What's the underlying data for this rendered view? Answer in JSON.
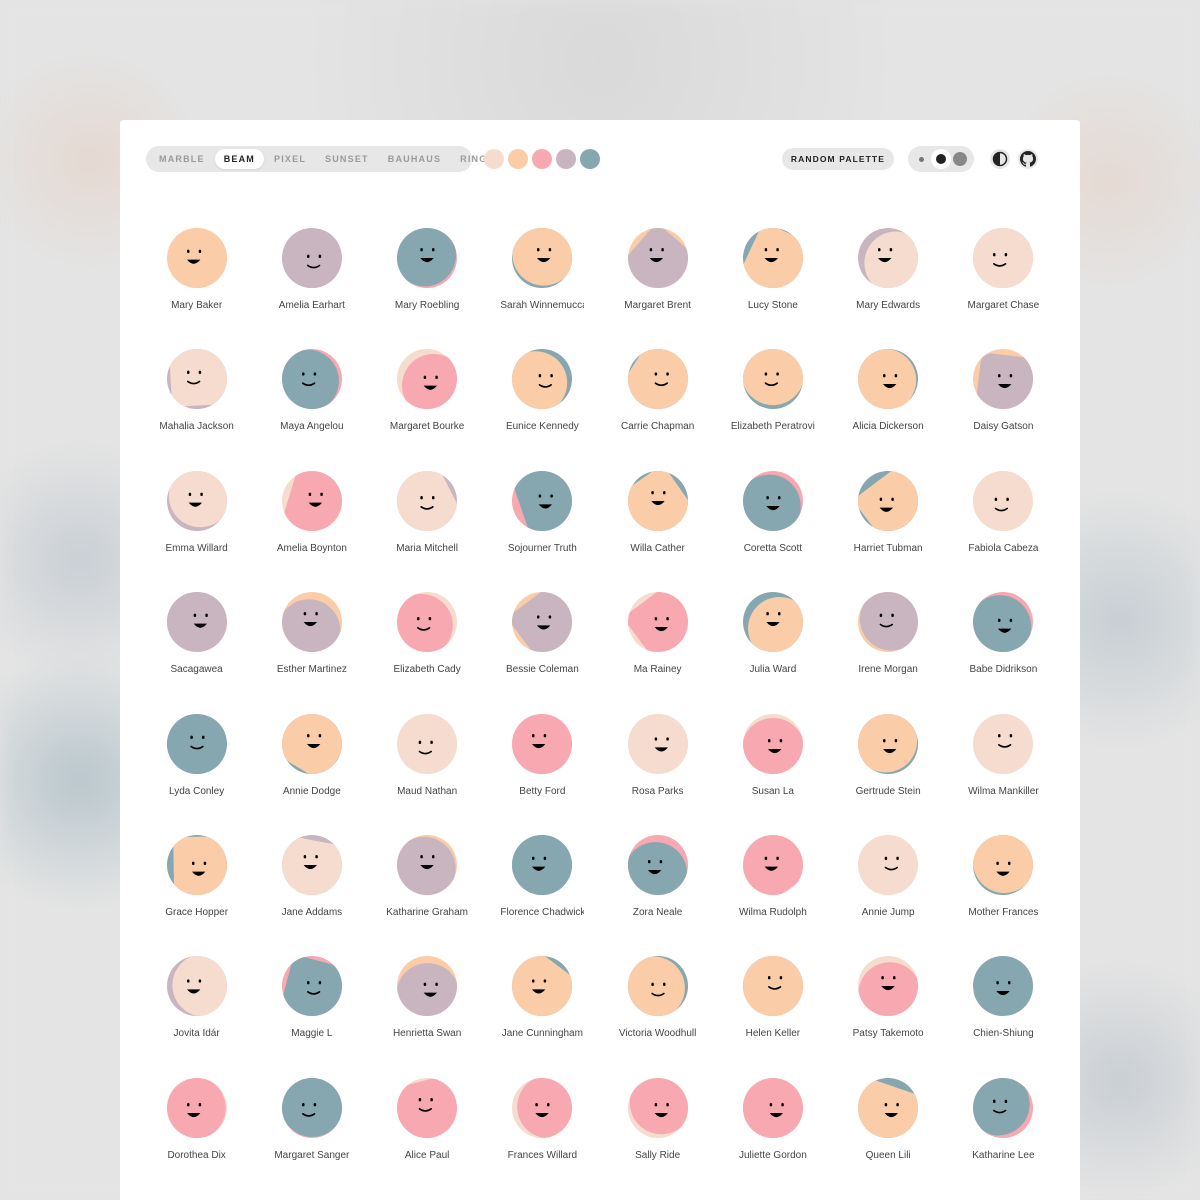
{
  "toolbar": {
    "variants": [
      "MARBLE",
      "BEAM",
      "PIXEL",
      "SUNSET",
      "BAUHAUS",
      "RING"
    ],
    "active_variant": "BEAM",
    "palette": [
      "#f6dccf",
      "#fbcca8",
      "#f7a8b0",
      "#c9b5bf",
      "#86a7b0"
    ],
    "random_palette_label": "RANDOM PALETTE",
    "size_options": [
      "small",
      "medium",
      "large"
    ],
    "active_size": "medium",
    "theme_icon": "contrast-icon",
    "github_icon": "github-icon"
  },
  "avatars": [
    {
      "name": "Mary Baker",
      "bg": "#fbcca8",
      "shape": "#fbcca8",
      "face": "#000"
    },
    {
      "name": "Amelia Earhart",
      "bg": "#c9b5bf",
      "shape": "#c9b5bf",
      "face": "#000"
    },
    {
      "name": "Mary Roebling",
      "bg": "#f7a8b0",
      "shape": "#86a7b0",
      "face": "#000"
    },
    {
      "name": "Sarah Winnemucca",
      "bg": "#86a7b0",
      "shape": "#fbcca8",
      "face": "#000"
    },
    {
      "name": "Margaret Brent",
      "bg": "#fbcca8",
      "shape": "#c9b5bf",
      "face": "#000"
    },
    {
      "name": "Lucy Stone",
      "bg": "#86a7b0",
      "shape": "#fbcca8",
      "face": "#000"
    },
    {
      "name": "Mary Edwards",
      "bg": "#c9b5bf",
      "shape": "#f6dccf",
      "face": "#000"
    },
    {
      "name": "Margaret Chase",
      "bg": "#c9b5bf",
      "shape": "#f6dccf",
      "face": "#000"
    },
    {
      "name": "Mahalia Jackson",
      "bg": "#c9b5bf",
      "shape": "#f6dccf",
      "face": "#000"
    },
    {
      "name": "Maya Angelou",
      "bg": "#f7a8b0",
      "shape": "#86a7b0",
      "face": "#000"
    },
    {
      "name": "Margaret Bourke",
      "bg": "#f6dccf",
      "shape": "#f7a8b0",
      "face": "#000"
    },
    {
      "name": "Eunice Kennedy",
      "bg": "#86a7b0",
      "shape": "#fbcca8",
      "face": "#000"
    },
    {
      "name": "Carrie Chapman",
      "bg": "#86a7b0",
      "shape": "#fbcca8",
      "face": "#000"
    },
    {
      "name": "Elizabeth Peratrovich",
      "bg": "#86a7b0",
      "shape": "#fbcca8",
      "face": "#000"
    },
    {
      "name": "Alicia Dickerson",
      "bg": "#86a7b0",
      "shape": "#fbcca8",
      "face": "#000"
    },
    {
      "name": "Daisy Gatson",
      "bg": "#fbcca8",
      "shape": "#c9b5bf",
      "face": "#000"
    },
    {
      "name": "Emma Willard",
      "bg": "#c9b5bf",
      "shape": "#f6dccf",
      "face": "#000"
    },
    {
      "name": "Amelia Boynton",
      "bg": "#f6dccf",
      "shape": "#f7a8b0",
      "face": "#000"
    },
    {
      "name": "Maria Mitchell",
      "bg": "#c9b5bf",
      "shape": "#f6dccf",
      "face": "#000"
    },
    {
      "name": "Sojourner Truth",
      "bg": "#f7a8b0",
      "shape": "#86a7b0",
      "face": "#000"
    },
    {
      "name": "Willa Cather",
      "bg": "#86a7b0",
      "shape": "#fbcca8",
      "face": "#000"
    },
    {
      "name": "Coretta Scott",
      "bg": "#f7a8b0",
      "shape": "#86a7b0",
      "face": "#000"
    },
    {
      "name": "Harriet Tubman",
      "bg": "#86a7b0",
      "shape": "#fbcca8",
      "face": "#000"
    },
    {
      "name": "Fabiola Cabeza",
      "bg": "#f6dccf",
      "shape": "#f6dccf",
      "face": "#000"
    },
    {
      "name": "Sacagawea",
      "bg": "#c9b5bf",
      "shape": "#c9b5bf",
      "face": "#000"
    },
    {
      "name": "Esther Martinez",
      "bg": "#fbcca8",
      "shape": "#c9b5bf",
      "face": "#000"
    },
    {
      "name": "Elizabeth Cady",
      "bg": "#f6dccf",
      "shape": "#f7a8b0",
      "face": "#000"
    },
    {
      "name": "Bessie Coleman",
      "bg": "#fbcca8",
      "shape": "#c9b5bf",
      "face": "#000"
    },
    {
      "name": "Ma Rainey",
      "bg": "#f6dccf",
      "shape": "#f7a8b0",
      "face": "#000"
    },
    {
      "name": "Julia Ward",
      "bg": "#86a7b0",
      "shape": "#fbcca8",
      "face": "#000"
    },
    {
      "name": "Irene Morgan",
      "bg": "#fbcca8",
      "shape": "#c9b5bf",
      "face": "#000"
    },
    {
      "name": "Babe Didrikson",
      "bg": "#f7a8b0",
      "shape": "#86a7b0",
      "face": "#000"
    },
    {
      "name": "Lyda Conley",
      "bg": "#86a7b0",
      "shape": "#86a7b0",
      "face": "#000"
    },
    {
      "name": "Annie Dodge",
      "bg": "#86a7b0",
      "shape": "#fbcca8",
      "face": "#000"
    },
    {
      "name": "Maud Nathan",
      "bg": "#f6dccf",
      "shape": "#f6dccf",
      "face": "#000"
    },
    {
      "name": "Betty Ford",
      "bg": "#f7a8b0",
      "shape": "#f7a8b0",
      "face": "#000"
    },
    {
      "name": "Rosa Parks",
      "bg": "#f6dccf",
      "shape": "#f6dccf",
      "face": "#000"
    },
    {
      "name": "Susan La",
      "bg": "#f6dccf",
      "shape": "#f7a8b0",
      "face": "#000"
    },
    {
      "name": "Gertrude Stein",
      "bg": "#86a7b0",
      "shape": "#fbcca8",
      "face": "#000"
    },
    {
      "name": "Wilma Mankiller",
      "bg": "#f6dccf",
      "shape": "#f6dccf",
      "face": "#000"
    },
    {
      "name": "Grace Hopper",
      "bg": "#86a7b0",
      "shape": "#fbcca8",
      "face": "#000"
    },
    {
      "name": "Jane Addams",
      "bg": "#c9b5bf",
      "shape": "#f6dccf",
      "face": "#000"
    },
    {
      "name": "Katharine Graham",
      "bg": "#fbcca8",
      "shape": "#c9b5bf",
      "face": "#000"
    },
    {
      "name": "Florence Chadwick",
      "bg": "#86a7b0",
      "shape": "#86a7b0",
      "face": "#000"
    },
    {
      "name": "Zora Neale",
      "bg": "#f7a8b0",
      "shape": "#86a7b0",
      "face": "#000"
    },
    {
      "name": "Wilma Rudolph",
      "bg": "#f6dccf",
      "shape": "#f7a8b0",
      "face": "#000"
    },
    {
      "name": "Annie Jump",
      "bg": "#f6dccf",
      "shape": "#f6dccf",
      "face": "#000"
    },
    {
      "name": "Mother Frances",
      "bg": "#86a7b0",
      "shape": "#fbcca8",
      "face": "#000"
    },
    {
      "name": "Jovita Idár",
      "bg": "#c9b5bf",
      "shape": "#f6dccf",
      "face": "#000"
    },
    {
      "name": "Maggie L",
      "bg": "#f7a8b0",
      "shape": "#86a7b0",
      "face": "#000"
    },
    {
      "name": "Henrietta Swan",
      "bg": "#fbcca8",
      "shape": "#c9b5bf",
      "face": "#000"
    },
    {
      "name": "Jane Cunningham",
      "bg": "#86a7b0",
      "shape": "#fbcca8",
      "face": "#000"
    },
    {
      "name": "Victoria Woodhull",
      "bg": "#86a7b0",
      "shape": "#fbcca8",
      "face": "#000"
    },
    {
      "name": "Helen Keller",
      "bg": "#86a7b0",
      "shape": "#fbcca8",
      "face": "#000"
    },
    {
      "name": "Patsy Takemoto",
      "bg": "#f6dccf",
      "shape": "#f7a8b0",
      "face": "#000"
    },
    {
      "name": "Chien-Shiung",
      "bg": "#f7a8b0",
      "shape": "#86a7b0",
      "face": "#000"
    },
    {
      "name": "Dorothea Dix",
      "bg": "#f6dccf",
      "shape": "#f7a8b0",
      "face": "#000"
    },
    {
      "name": "Margaret Sanger",
      "bg": "#f7a8b0",
      "shape": "#86a7b0",
      "face": "#000"
    },
    {
      "name": "Alice Paul",
      "bg": "#f6dccf",
      "shape": "#f7a8b0",
      "face": "#000"
    },
    {
      "name": "Frances Willard",
      "bg": "#f6dccf",
      "shape": "#f7a8b0",
      "face": "#000"
    },
    {
      "name": "Sally Ride",
      "bg": "#f6dccf",
      "shape": "#f7a8b0",
      "face": "#000"
    },
    {
      "name": "Juliette Gordon",
      "bg": "#f7a8b0",
      "shape": "#f7a8b0",
      "face": "#000"
    },
    {
      "name": "Queen Lili",
      "bg": "#86a7b0",
      "shape": "#fbcca8",
      "face": "#000"
    },
    {
      "name": "Katharine Lee",
      "bg": "#f7a8b0",
      "shape": "#86a7b0",
      "face": "#000"
    }
  ]
}
